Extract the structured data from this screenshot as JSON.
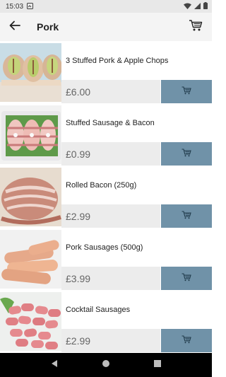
{
  "status_bar": {
    "time": "15:03"
  },
  "app_bar": {
    "title": "Pork"
  },
  "products": [
    {
      "name": "3 Stuffed Pork & Apple Chops",
      "price": "£6.00"
    },
    {
      "name": "Stuffed Sausage & Bacon",
      "price": "£0.99"
    },
    {
      "name": "Rolled Bacon (250g)",
      "price": "£2.99"
    },
    {
      "name": "Pork Sausages (500g)",
      "price": "£3.99"
    },
    {
      "name": "Cocktail Sausages",
      "price": "£2.99"
    }
  ],
  "icons": {
    "back": "arrow-left-icon",
    "cart": "shopping-cart-icon",
    "add_to_cart": "cart-add-icon",
    "nav_back": "triangle-back-icon",
    "nav_home": "circle-home-icon",
    "nav_recents": "square-recents-icon"
  },
  "colors": {
    "accent": "#7092a8",
    "price_bar": "#ececec",
    "status_bar": "#e8e8e8",
    "app_bar": "#f4f4f4",
    "nav_bar": "#000000"
  }
}
